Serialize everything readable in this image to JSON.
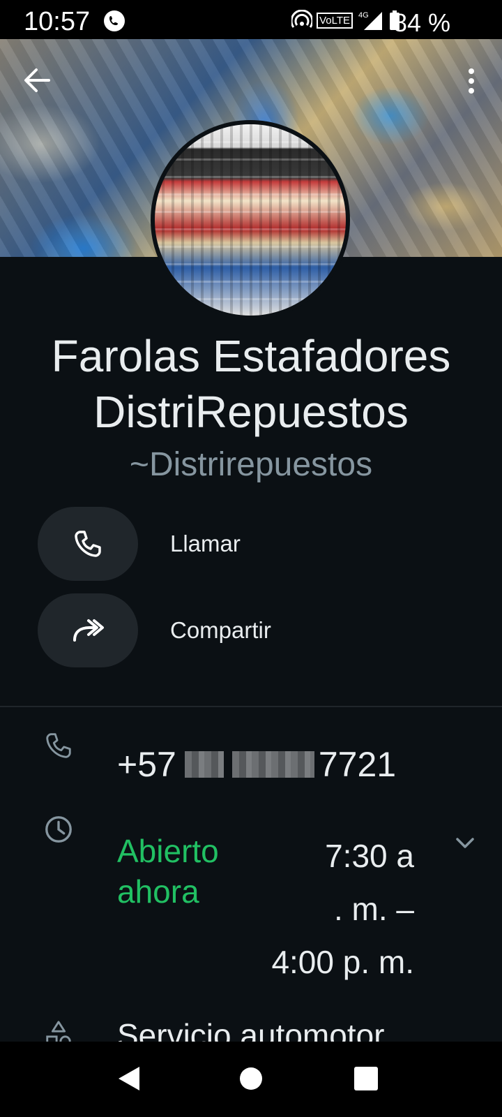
{
  "status_bar": {
    "time": "10:57",
    "battery_pct": "84 %",
    "network": "4G",
    "volte": "VoLTE"
  },
  "profile": {
    "name_line1": "Farolas Estafadores",
    "name_line2": "DistriRepuestos",
    "push_name": "~Distrirepuestos"
  },
  "actions": [
    {
      "label": "Llamar",
      "icon": "phone-icon"
    },
    {
      "label": "Compartir",
      "icon": "share-icon"
    }
  ],
  "info": {
    "phone_prefix": "+57",
    "phone_suffix": "7721",
    "open_status_line1": "Abierto",
    "open_status_line2": "ahora",
    "hours_line1": "7:30 a",
    "hours_line2": ". m. –",
    "hours_line3": "4:00 p. m.",
    "category": "Servicio automotor"
  },
  "colors": {
    "background": "#0b1014",
    "accent_green": "#21c063",
    "secondary_text": "#8696a0",
    "pill": "#20262b"
  }
}
